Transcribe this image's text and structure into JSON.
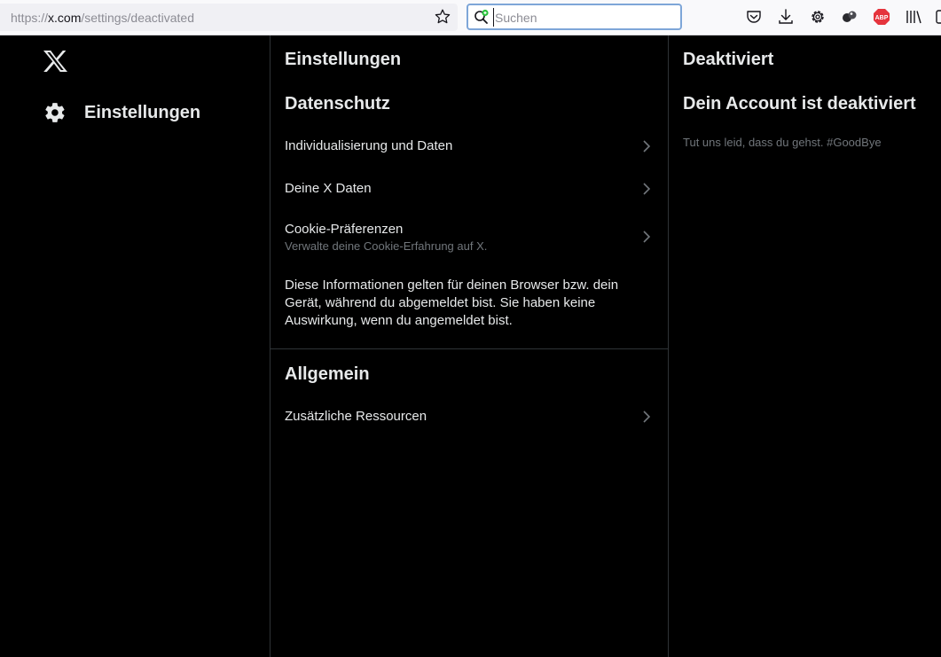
{
  "browser": {
    "url_prefix": "https://",
    "url_host": "x.com",
    "url_path": "/settings/deactivated",
    "search_placeholder": "Suchen",
    "icons": [
      "star-icon",
      "search-icon",
      "pocket-icon",
      "download-icon",
      "gear-icon",
      "extension-icon",
      "abp-icon",
      "library-icon",
      "sidebar-icon"
    ],
    "abp_label": "ABP",
    "abp_color": "#e5343d"
  },
  "nav": {
    "logo": "x-logo-icon",
    "item_label": "Einstellungen",
    "item_icon": "gear-icon"
  },
  "settings": {
    "title": "Einstellungen",
    "privacy_heading": "Datenschutz",
    "rows": [
      {
        "label": "Individualisierung und Daten"
      },
      {
        "label": "Deine X Daten"
      },
      {
        "label": "Cookie-Präferenzen",
        "sub": "Verwalte deine Cookie-Erfahrung auf X."
      }
    ],
    "info": "Diese Informationen gelten für deinen Browser bzw. dein Gerät, während du abgemeldet bist. Sie haben keine Auswirkung, wenn du angemeldet bist.",
    "general_heading": "Allgemein",
    "general_rows": [
      {
        "label": "Zusätzliche Ressourcen"
      }
    ]
  },
  "detail": {
    "title": "Deaktiviert",
    "heading": "Dein Account ist deaktiviert",
    "text": "Tut uns leid, dass du gehst. #GoodBye"
  },
  "colors": {
    "background": "#000000",
    "text_primary": "#e7e9ea",
    "text_secondary": "#71767b",
    "border": "#2f3336"
  }
}
